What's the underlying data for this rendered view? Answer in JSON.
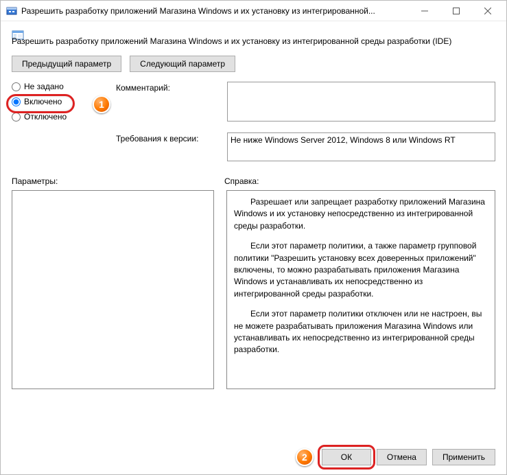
{
  "titlebar": {
    "title": "Разрешить разработку приложений Магазина Windows и их установку из интегрированной..."
  },
  "subtitle": "Разрешить разработку приложений Магазина Windows и их установку из интегрированной среды разработки (IDE)",
  "nav": {
    "prev": "Предыдущий параметр",
    "next": "Следующий параметр"
  },
  "radios": {
    "not_configured": "Не задано",
    "enabled": "Включено",
    "disabled": "Отключено"
  },
  "labels": {
    "comment": "Комментарий:",
    "requirements": "Требования к версии:",
    "params": "Параметры:",
    "help": "Справка:"
  },
  "fields": {
    "comment": "",
    "requirements": "Не ниже Windows Server 2012, Windows 8 или Windows RT"
  },
  "help": {
    "p1": "Разрешает или запрещает разработку приложений Магазина Windows и их установку непосредственно из интегрированной среды разработки.",
    "p2": "Если этот параметр политики, а также параметр групповой политики \"Разрешить установку всех доверенных приложений\" включены, то можно разрабатывать приложения Магазина Windows и устанавливать их непосредственно из интегрированной среды разработки.",
    "p3": "Если этот параметр политики отключен или не настроен, вы не можете разрабатывать приложения Магазина Windows или устанавливать их непосредственно из интегрированной среды разработки."
  },
  "footer": {
    "ok": "ОК",
    "cancel": "Отмена",
    "apply": "Применить"
  },
  "badges": {
    "one": "1",
    "two": "2"
  }
}
